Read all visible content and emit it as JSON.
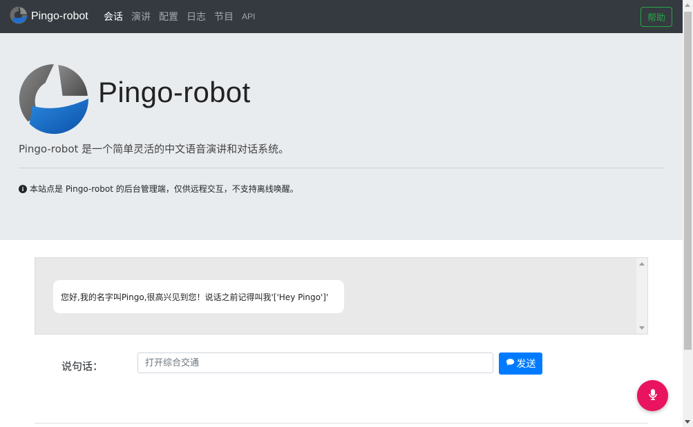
{
  "navbar": {
    "brand": "Pingo-robot",
    "links": [
      "会话",
      "演讲",
      "配置",
      "日志",
      "节目",
      "API"
    ],
    "active_index": 0,
    "help_label": "帮助"
  },
  "jumbotron": {
    "title": "Pingo-robot",
    "lead": "Pingo-robot 是一个简单灵活的中文语音演讲和对话系统。",
    "notice": "本站点是 Pingo-robot 的后台管理端，仅供远程交互，不支持离线唤醒。"
  },
  "chat": {
    "messages": [
      "您好,我的名字叫Pingo,很高兴见到您！说话之前记得叫我'['Hey Pingo']'"
    ]
  },
  "input": {
    "label": "说句话：",
    "placeholder": "打开综合交通",
    "send_label": "发送"
  },
  "colors": {
    "navbar_bg": "#343a40",
    "help": "#28a745",
    "send": "#007bff",
    "mic": "#e8145f"
  },
  "icons": {
    "brand": "pingo-logo-icon",
    "notice": "info-circle-icon",
    "send": "comment-icon",
    "mic": "microphone-icon"
  }
}
